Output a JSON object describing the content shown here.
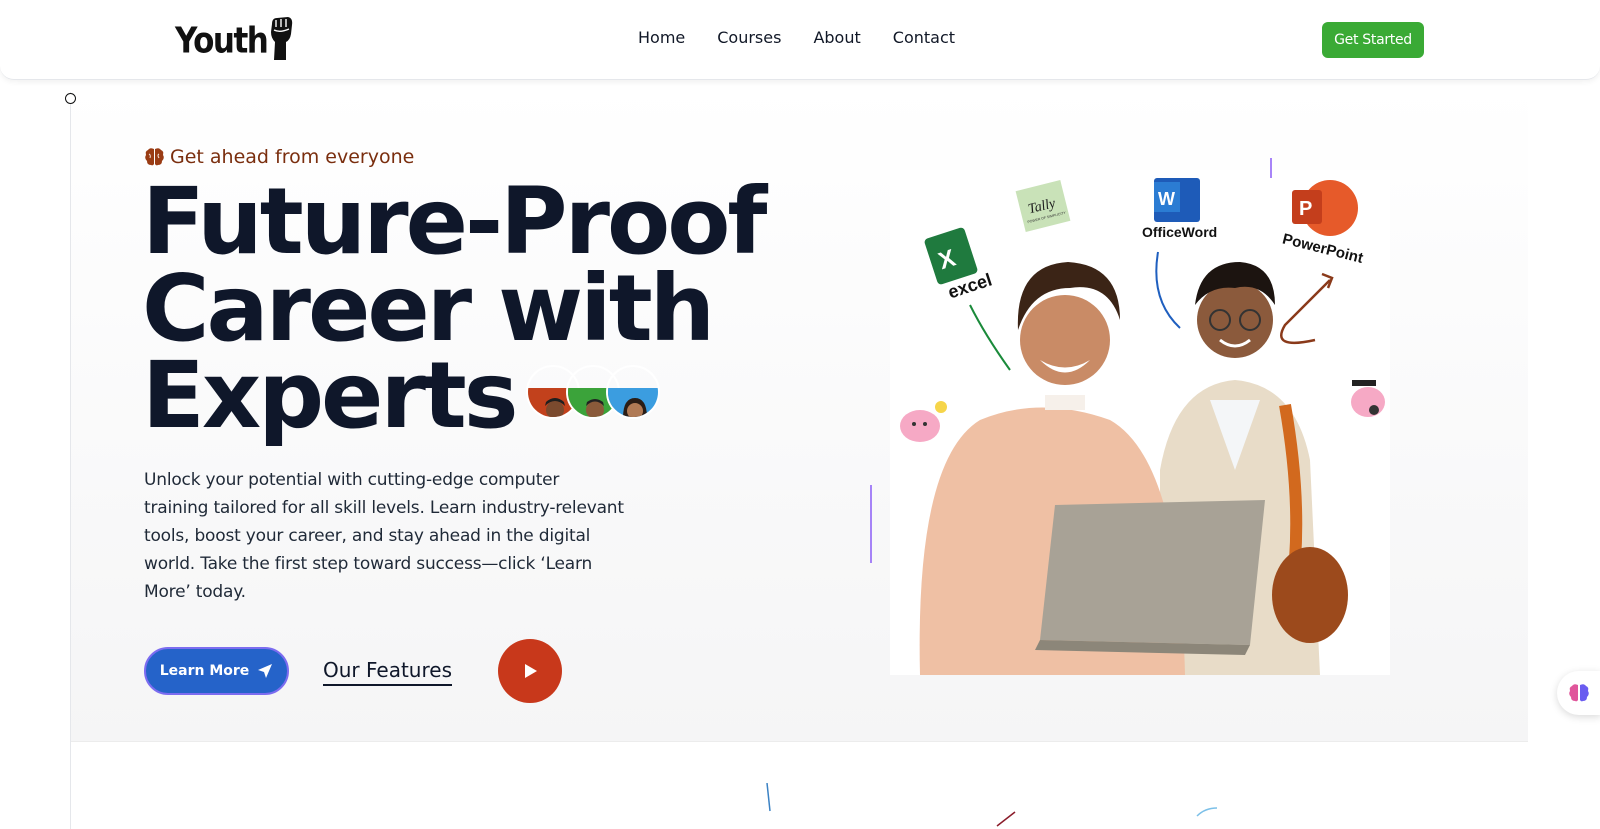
{
  "header": {
    "logo_text": "Youth",
    "nav": [
      {
        "label": "Home"
      },
      {
        "label": "Courses"
      },
      {
        "label": "About"
      },
      {
        "label": "Contact"
      }
    ],
    "cta_label": "Get Started"
  },
  "hero": {
    "eyebrow": "Get ahead from everyone",
    "title_line1": "Future-Proof",
    "title_line2": "Career  with",
    "title_line3": "Experts",
    "description": "Unlock your potential with cutting-edge computer training tailored for all skill levels. Learn industry-relevant tools, boost your career, and stay ahead in the digital world. Take the first step toward success—click ‘Learn More’ today.",
    "learn_more_label": "Learn More",
    "features_label": "Our Features",
    "image_labels": {
      "excel": "excel",
      "tally": "Tally",
      "tally_tagline": "POWER OF SIMPLICITY",
      "word": "OfficeWord",
      "powerpoint": "PowerPoint"
    }
  },
  "colors": {
    "accent_green": "#3aaa35",
    "primary_blue": "#2563c9",
    "play_red": "#c8381b",
    "eyebrow_brown": "#7a2e0e",
    "title_navy": "#0f172a"
  }
}
